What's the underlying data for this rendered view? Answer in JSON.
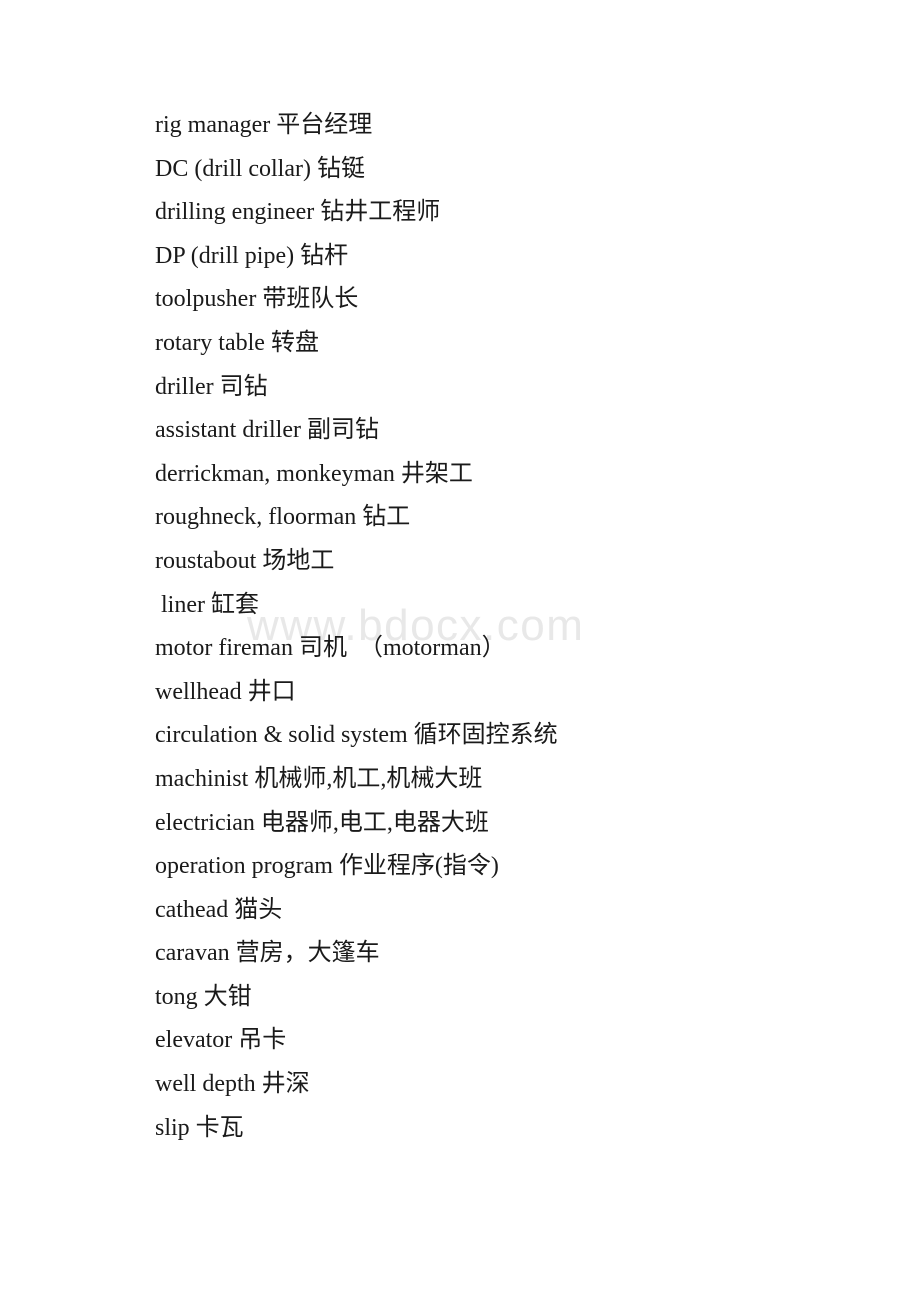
{
  "document": {
    "page_background": "#ffffff",
    "text_color": "#1a1a1a",
    "watermark": {
      "text": "www.bdocx.com",
      "color": "#e8e8e8"
    },
    "lines": [
      {
        "id": "rig-manager",
        "text": "rig manager 平台经理"
      },
      {
        "id": "drill-collar",
        "text": "DC (drill collar) 钻铤"
      },
      {
        "id": "drilling-engineer",
        "text": "drilling engineer 钻井工程师"
      },
      {
        "id": "drill-pipe",
        "text": "DP (drill pipe) 钻杆"
      },
      {
        "id": "toolpusher",
        "text": "toolpusher 带班队长"
      },
      {
        "id": "rotary-table",
        "text": "rotary table 转盘"
      },
      {
        "id": "driller",
        "text": "driller 司钻"
      },
      {
        "id": "assistant-driller",
        "text": "assistant driller 副司钻"
      },
      {
        "id": "derrickman",
        "text": "derrickman, monkeyman 井架工"
      },
      {
        "id": "roughneck",
        "text": "roughneck, floorman 钻工"
      },
      {
        "id": "roustabout",
        "text": "roustabout 场地工"
      },
      {
        "id": "liner",
        "text": " liner 缸套"
      },
      {
        "id": "motor-fireman",
        "text": "motor fireman 司机　（motorman）"
      },
      {
        "id": "wellhead",
        "text": "wellhead 井口"
      },
      {
        "id": "circulation-solid",
        "text": "circulation & solid system 循环固控系统"
      },
      {
        "id": "machinist",
        "text": "machinist 机械师,机工,机械大班"
      },
      {
        "id": "electrician",
        "text": "electrician 电器师,电工,电器大班"
      },
      {
        "id": "operation-program",
        "text": "operation program 作业程序(指令)"
      },
      {
        "id": "cathead",
        "text": "cathead 猫头"
      },
      {
        "id": "caravan",
        "text": "caravan 营房，大篷车"
      },
      {
        "id": "tong",
        "text": "tong 大钳"
      },
      {
        "id": "elevator",
        "text": "elevator 吊卡"
      },
      {
        "id": "well-depth",
        "text": "well depth 井深"
      },
      {
        "id": "slip",
        "text": "slip 卡瓦"
      }
    ]
  }
}
